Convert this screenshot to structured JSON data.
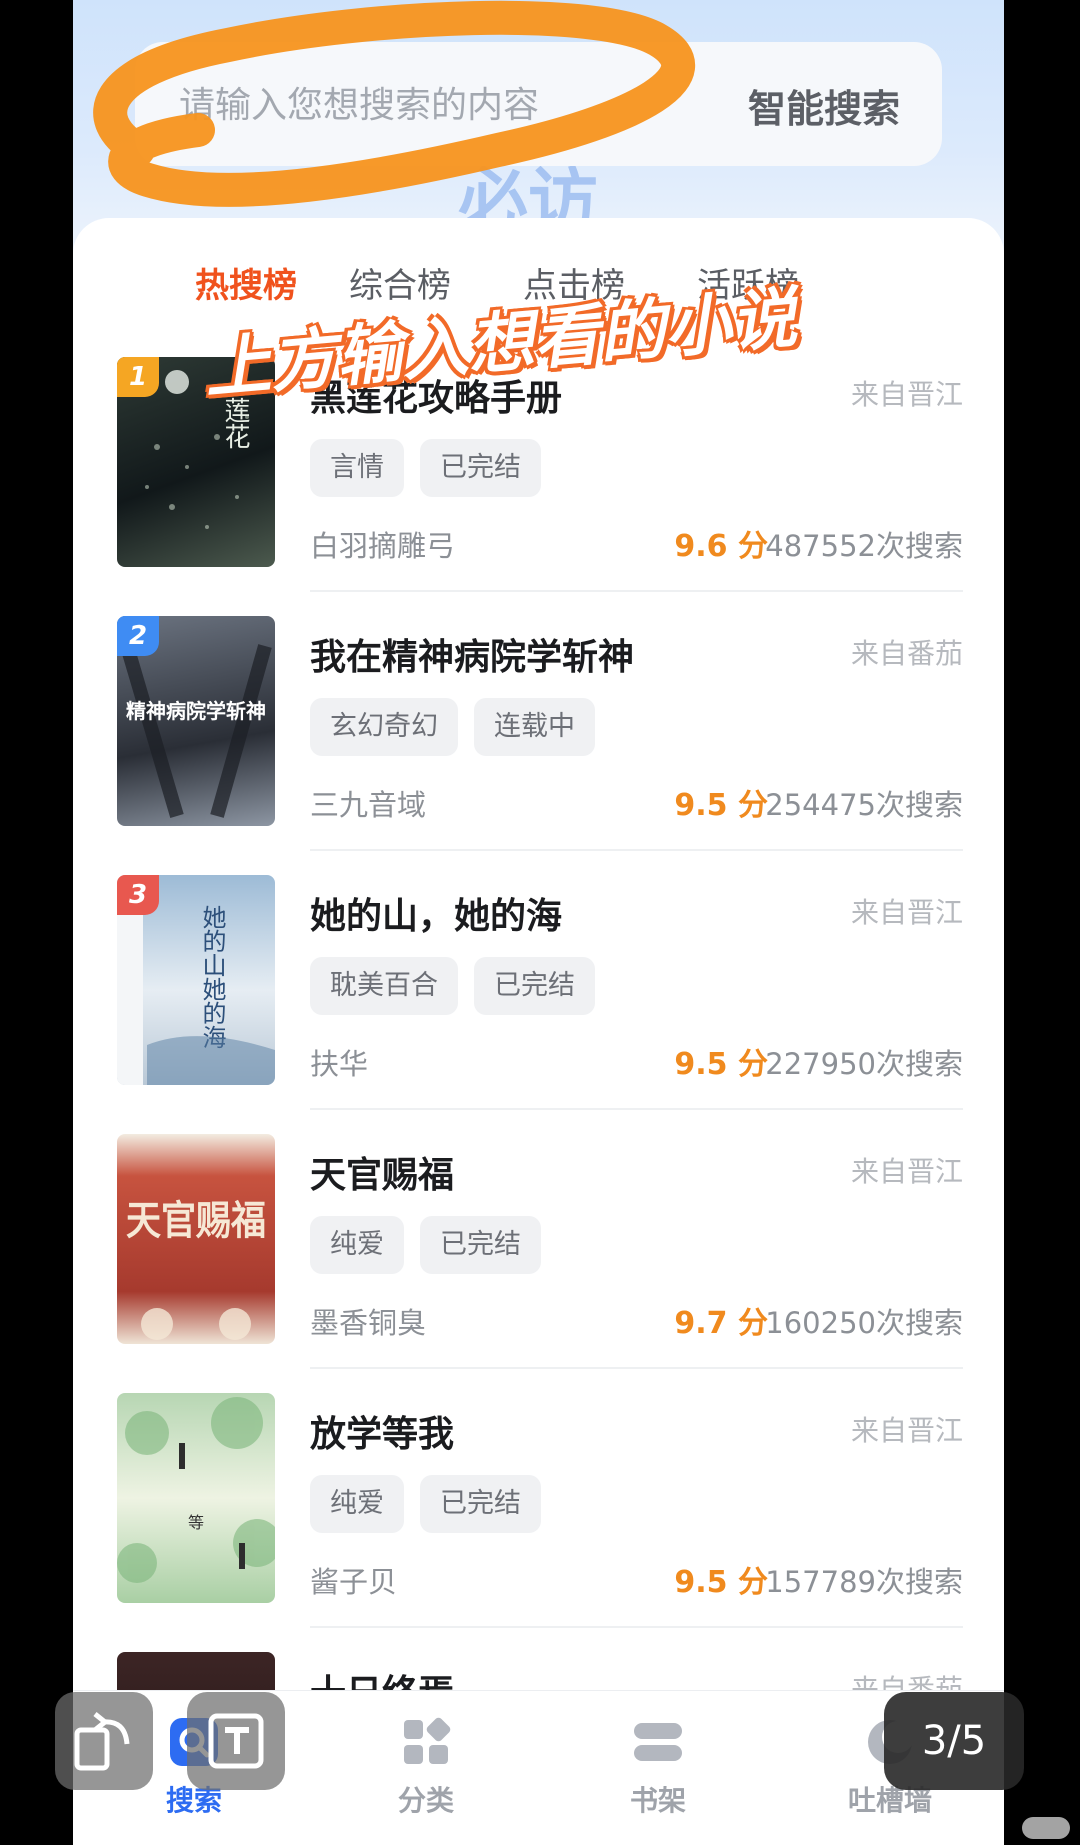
{
  "search": {
    "placeholder": "请输入您想搜索的内容",
    "button_label": "智能搜索",
    "background_word": "必访"
  },
  "annotation": {
    "text": "上方输入想看的小说",
    "color": "#f26a28"
  },
  "tabs": [
    {
      "label": "热搜榜",
      "active": true
    },
    {
      "label": "综合榜",
      "active": false
    },
    {
      "label": "点击榜",
      "active": false
    },
    {
      "label": "活跃榜",
      "active": false
    }
  ],
  "books": [
    {
      "rank": "1",
      "title": "黑莲花攻略手册",
      "source": "来自晋江",
      "tags": [
        "言情",
        "已完结"
      ],
      "author": "白羽摘雕弓",
      "score": "9.6 分",
      "count": "487552次搜索",
      "rank_color": "#f5a623",
      "cover_art": "莲花",
      "cover_colors": [
        "#1d2a26",
        "#4b5a50"
      ]
    },
    {
      "rank": "2",
      "title": "我在精神病院学斩神",
      "source": "来自番茄",
      "tags": [
        "玄幻奇幻",
        "连载中"
      ],
      "author": "三九音域",
      "score": "9.5 分",
      "count": "254475次搜索",
      "rank_color": "#3f8cf3",
      "cover_art": "精神病院学斩神",
      "cover_colors": [
        "#3a3f4a",
        "#9aa2b0"
      ]
    },
    {
      "rank": "3",
      "title": "她的山，她的海",
      "source": "来自晋江",
      "tags": [
        "耽美百合",
        "已完结"
      ],
      "author": "扶华",
      "score": "9.5 分",
      "count": "227950次搜索",
      "rank_color": "#e8584f",
      "cover_art": "她的山她的海",
      "cover_colors": [
        "#7fa6c8",
        "#e7eef5"
      ]
    },
    {
      "rank": "",
      "title": "天官赐福",
      "source": "来自晋江",
      "tags": [
        "纯爱",
        "已完结"
      ],
      "author": "墨香铜臭",
      "score": "9.7 分",
      "count": "160250次搜索",
      "rank_color": "",
      "cover_art": "天官赐福",
      "cover_colors": [
        "#b8473a",
        "#e9d8c4"
      ]
    },
    {
      "rank": "",
      "title": "放学等我",
      "source": "来自晋江",
      "tags": [
        "纯爱",
        "已完结"
      ],
      "author": "酱子贝",
      "score": "9.5 分",
      "count": "157789次搜索",
      "rank_color": "",
      "cover_art": "等",
      "cover_colors": [
        "#9cc6a2",
        "#eef3e6"
      ]
    },
    {
      "rank": "",
      "title": "十日终焉",
      "source": "来自番茄",
      "tags": [],
      "author": "",
      "score": "",
      "count": "",
      "rank_color": "",
      "cover_art": "",
      "cover_colors": [
        "#3a2020",
        "#141010"
      ]
    }
  ],
  "bottom_nav": [
    {
      "label": "搜索",
      "icon": "search-icon",
      "active": true
    },
    {
      "label": "分类",
      "icon": "category-icon",
      "active": false
    },
    {
      "label": "书架",
      "icon": "bookshelf-icon",
      "active": false
    },
    {
      "label": "吐槽墙",
      "icon": "comment-wall-icon",
      "active": false
    }
  ],
  "viewer": {
    "page_indicator": "3/5"
  },
  "colors": {
    "accent_active_tab": "#f0521d",
    "score": "#f08a1e",
    "nav_active": "#2d6cf2"
  }
}
